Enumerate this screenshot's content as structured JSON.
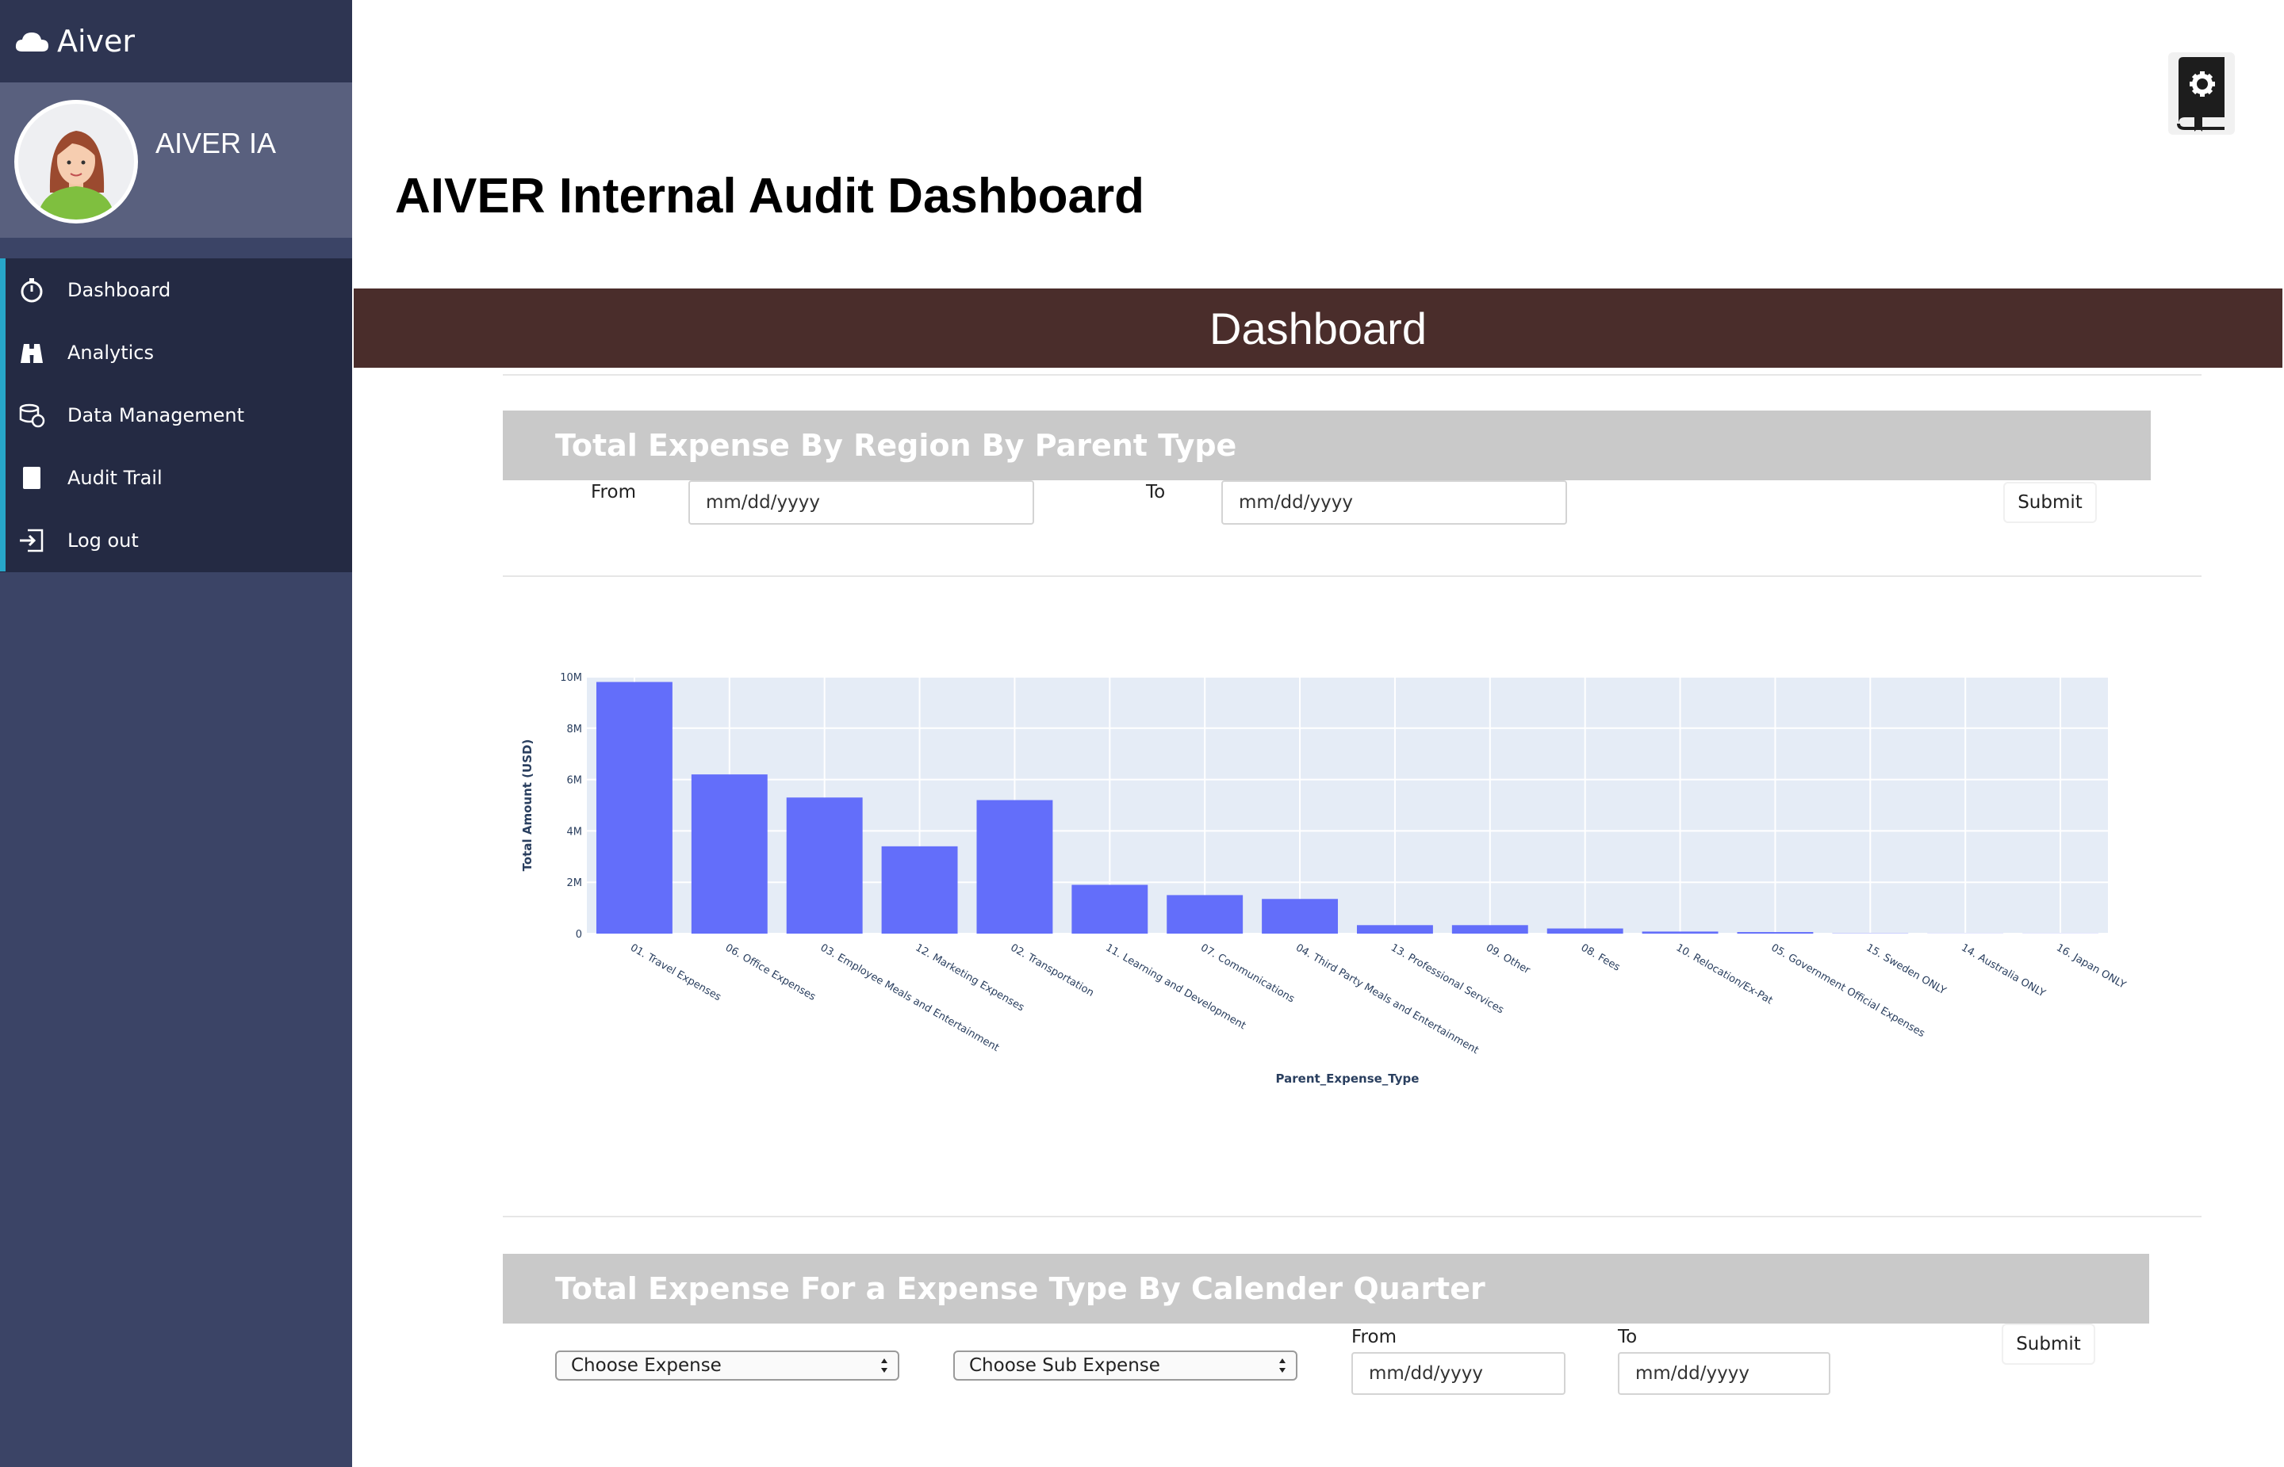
{
  "brand": {
    "name": "Aiver",
    "icon": "cloud-icon"
  },
  "profile": {
    "name": "AIVER IA",
    "avatar": "user-avatar-woman"
  },
  "sidebar": {
    "items": [
      {
        "label": "Dashboard",
        "icon": "stopwatch-icon"
      },
      {
        "label": "Analytics",
        "icon": "binoculars-icon"
      },
      {
        "label": "Data Management",
        "icon": "database-icon"
      },
      {
        "label": "Audit Trail",
        "icon": "document-icon"
      },
      {
        "label": "Log out",
        "icon": "logout-icon"
      }
    ]
  },
  "header": {
    "title": "AIVER Internal Audit Dashboard",
    "bar_title": "Dashboard",
    "settings_icon": "settings-book-icon"
  },
  "colors": {
    "sidebar": "#3b4466",
    "nav": "#242a43",
    "accent": "#27a6c9",
    "banner": "#4a2d2b",
    "bar": "#636efa"
  },
  "panel1": {
    "title": "Total Expense By Region By Parent Type",
    "from_label": "From",
    "to_label": "To",
    "from_placeholder": "mm/dd/yyyy",
    "to_placeholder": "mm/dd/yyyy",
    "submit_label": "Submit"
  },
  "panel2": {
    "title": "Total Expense For a Expense Type By Calender Quarter",
    "expense_select": "Choose Expense",
    "sub_expense_select": "Choose Sub Expense",
    "from_label": "From",
    "to_label": "To",
    "from_placeholder": "mm/dd/yyyy",
    "to_placeholder": "mm/dd/yyyy",
    "submit_label": "Submit"
  },
  "chart_data": {
    "type": "bar",
    "xlabel": "Parent_Expense_Type",
    "ylabel": "Total Amount (USD)",
    "ylim": [
      0,
      10000000
    ],
    "yticks": [
      0,
      2000000,
      4000000,
      6000000,
      8000000,
      10000000
    ],
    "ytick_labels": [
      "0",
      "2M",
      "4M",
      "6M",
      "8M",
      "10M"
    ],
    "grid": true,
    "categories": [
      "01. Travel Expenses",
      "06. Office Expenses",
      "03. Employee Meals and Entertainment",
      "12. Marketing Expenses",
      "02. Transportation",
      "11. Learning and Development",
      "07. Communications",
      "04. Third Party Meals and Entertainment",
      "13. Professional Services",
      "09. Other",
      "08. Fees",
      "10. Relocation/Ex-Pat",
      "05. Government Official Expenses",
      "15. Sweden ONLY",
      "14. Australia ONLY",
      "16. Japan ONLY"
    ],
    "values": [
      9800000,
      6200000,
      5300000,
      3400000,
      5200000,
      1900000,
      1500000,
      1350000,
      330000,
      330000,
      200000,
      80000,
      60000,
      10000,
      5000,
      5000
    ]
  }
}
